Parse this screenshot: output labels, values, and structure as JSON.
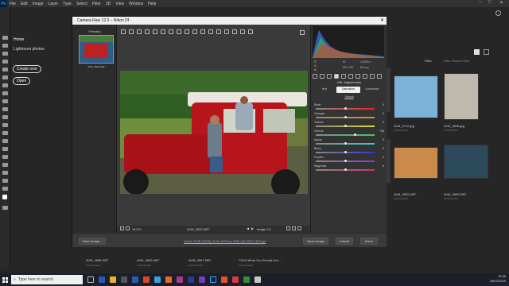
{
  "menubar": {
    "logo": "Ps",
    "items": [
      "File",
      "Edit",
      "Image",
      "Layer",
      "Type",
      "Select",
      "Filter",
      "3D",
      "View",
      "Window",
      "Help"
    ]
  },
  "home_panel": {
    "home": "Home",
    "lightroom": "Lightroom photos",
    "create_new": "Create new",
    "open": "Open"
  },
  "gallery_toolbar": {
    "filter": "Filter",
    "filter_placeholder": "Filter Recent Files"
  },
  "right_gallery": [
    {
      "name": "AVM_3710.jpg",
      "age": "3 DAYS AGO",
      "color": "#6a9fc8"
    },
    {
      "name": "AVM_3645.jpg",
      "age": "3 DAYS AGO",
      "color": "#b9b3a8"
    },
    {
      "name": "AVM_3805.NEF",
      "age": "3 DAYS AGO",
      "color": "#c98a4a"
    },
    {
      "name": "AVM_3599.NEF",
      "age": "3 DAYS AGO",
      "color": "#2c4a5c"
    }
  ],
  "bottom_strip": [
    {
      "name": "AVM_3668.NEF",
      "age": "3 DAYS AGO"
    },
    {
      "name": "AVM_3653.NEF",
      "age": "3 DAYS AGO"
    },
    {
      "name": "AVM_3597.NEF",
      "age": "3 DAYS AGO"
    },
    {
      "name": "CH1A What You Should Kno...",
      "age": "3 DAYS AGO"
    }
  ],
  "camera_raw": {
    "title": "Camera Raw 12.0  –  Nikon Df",
    "filmstrip_label": "Filmstrip",
    "film_name": "AVM_3625.NEF",
    "zoom": "16.2%",
    "filename": "AVM_3625.NEF",
    "image_count": "Image 1/1",
    "save_button": "Save Image...",
    "workflow_link": "Adobe RGB (1998); 8 bit; 4928 by 3280 (16.2MP); 300 ppi",
    "open_button": "Open Image",
    "cancel_button": "Cancel",
    "done_button": "Done",
    "info": {
      "r": "R:",
      "g": "G:",
      "b": "B:",
      "f": "f/2",
      "iso": "ISO 100",
      "shutter": "1/2000 s",
      "focal": "85 mm"
    },
    "hsl_title": "HSL Adjustments",
    "hsl_tabs": [
      "Hue",
      "Saturation",
      "Luminance"
    ],
    "active_tab_index": 1,
    "default_link": "Default",
    "sliders": [
      {
        "label": "Reds",
        "value": "0",
        "pos": 0.5,
        "from": "#e22",
        "to": "#e22"
      },
      {
        "label": "Oranges",
        "value": "0",
        "pos": 0.5,
        "from": "#c33",
        "to": "#e82"
      },
      {
        "label": "Yellows",
        "value": "0",
        "pos": 0.5,
        "from": "#c83",
        "to": "#dd3"
      },
      {
        "label": "Greens",
        "value": "+33",
        "pos": 0.67,
        "from": "#9c3",
        "to": "#3c6"
      },
      {
        "label": "Aquas",
        "value": "0",
        "pos": 0.5,
        "from": "#3c9",
        "to": "#3cc"
      },
      {
        "label": "Blues",
        "value": "0",
        "pos": 0.5,
        "from": "#39c",
        "to": "#33c"
      },
      {
        "label": "Purples",
        "value": "0",
        "pos": 0.5,
        "from": "#63c",
        "to": "#93c"
      },
      {
        "label": "Magentas",
        "value": "0",
        "pos": 0.5,
        "from": "#c3c",
        "to": "#c36"
      }
    ]
  },
  "taskbar": {
    "search_placeholder": "Type here to search",
    "time": "19:36",
    "date": "28/02/2020"
  }
}
